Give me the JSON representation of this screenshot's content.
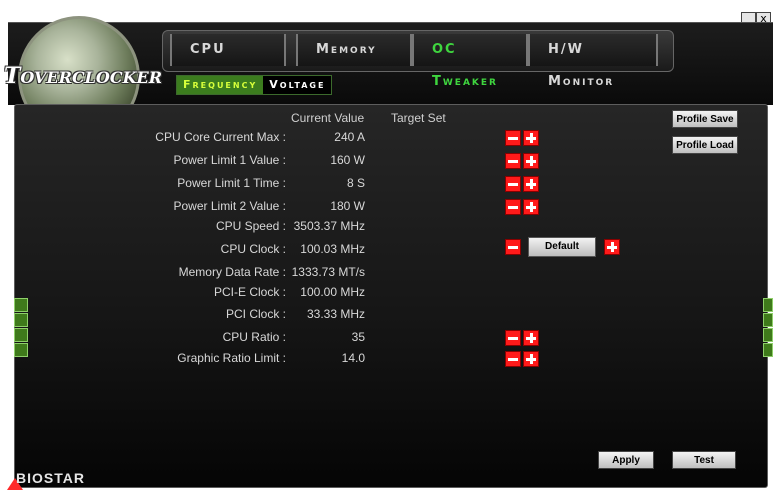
{
  "window": {
    "minimize_glyph": "_",
    "close_glyph": "x"
  },
  "logo": {
    "text": "OVERCLOCKER"
  },
  "tabs": [
    {
      "label": "CPU"
    },
    {
      "label": "Memory"
    },
    {
      "label": "OC Tweaker"
    },
    {
      "label": "H/W Monitor"
    }
  ],
  "subtabs": [
    {
      "label": "Frequency"
    },
    {
      "label": "Voltage"
    }
  ],
  "columns": {
    "current_value": "Current Value",
    "target_set": "Target Set"
  },
  "rows": [
    {
      "label": "CPU Core Current Max :",
      "value": "240 A"
    },
    {
      "label": "Power Limit 1 Value :",
      "value": "160 W"
    },
    {
      "label": "Power Limit 1 Time :",
      "value": "8 S"
    },
    {
      "label": "Power Limit 2 Value :",
      "value": "180 W"
    },
    {
      "label": "CPU Speed :",
      "value": "3503.37 MHz"
    },
    {
      "label": "CPU Clock :",
      "value": "100.03 MHz"
    },
    {
      "label": "Memory Data Rate :",
      "value": "1333.73 MT/s"
    },
    {
      "label": "PCI-E Clock :",
      "value": "100.00 MHz"
    },
    {
      "label": "PCI Clock :",
      "value": "33.33 MHz"
    },
    {
      "label": "CPU Ratio :",
      "value": "35"
    },
    {
      "label": "Graphic Ratio Limit :",
      "value": "14.0"
    }
  ],
  "buttons": {
    "profile_save": "Profile Save",
    "profile_load": "Profile Load",
    "default": "Default",
    "apply": "Apply",
    "test": "Test"
  },
  "brand": {
    "text": "BIOSTAR"
  },
  "icons": {
    "minus": "minus-icon",
    "plus": "plus-icon"
  },
  "colors": {
    "active_tab": "#3fd63f",
    "active_subtab_bg": "#3c7d1e",
    "decrement_red": "#ff1a1a"
  }
}
